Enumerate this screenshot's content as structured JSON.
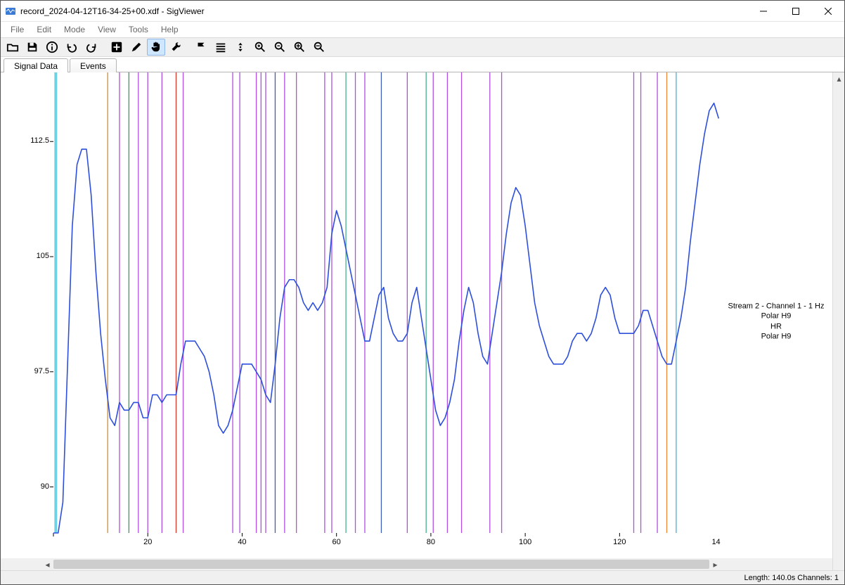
{
  "window": {
    "title": "record_2024-04-12T16-34-25+00.xdf - SigViewer"
  },
  "menu": {
    "file": "File",
    "edit": "Edit",
    "mode": "Mode",
    "view": "View",
    "tools": "Tools",
    "help": "Help"
  },
  "tabs": {
    "signal": "Signal Data",
    "events": "Events"
  },
  "side_label": {
    "l1": "Stream 2 - Channel 1 - 1 Hz",
    "l2": "Polar H9",
    "l3": "HR",
    "l4": "Polar H9"
  },
  "status": {
    "text": "Length: 140.0s  Channels: 1"
  },
  "chart_data": {
    "type": "line",
    "xlabel": "",
    "ylabel": "",
    "xlim": [
      0,
      142
    ],
    "ylim": [
      87,
      117
    ],
    "x_ticks": [
      20,
      40,
      60,
      80,
      100,
      120
    ],
    "x_tick_label_extra": "14",
    "y_ticks": [
      90,
      97.5,
      105,
      112.5
    ],
    "series": [
      {
        "name": "HR",
        "color": "#2d4fdc",
        "x": [
          0,
          1,
          2,
          3,
          4,
          5,
          6,
          7,
          8,
          9,
          10,
          11,
          12,
          13,
          14,
          15,
          16,
          17,
          18,
          19,
          20,
          21,
          22,
          23,
          24,
          25,
          26,
          27,
          28,
          29,
          30,
          31,
          32,
          33,
          34,
          35,
          36,
          37,
          38,
          39,
          40,
          41,
          42,
          43,
          44,
          45,
          46,
          47,
          48,
          49,
          50,
          51,
          52,
          53,
          54,
          55,
          56,
          57,
          58,
          59,
          60,
          61,
          62,
          63,
          64,
          65,
          66,
          67,
          68,
          69,
          70,
          71,
          72,
          73,
          74,
          75,
          76,
          77,
          78,
          79,
          80,
          81,
          82,
          83,
          84,
          85,
          86,
          87,
          88,
          89,
          90,
          91,
          92,
          93,
          94,
          95,
          96,
          97,
          98,
          99,
          100,
          101,
          102,
          103,
          104,
          105,
          106,
          107,
          108,
          109,
          110,
          111,
          112,
          113,
          114,
          115,
          116,
          117,
          118,
          119,
          120,
          121,
          122,
          123,
          124,
          125,
          126,
          127,
          128,
          129,
          130,
          131,
          132,
          133,
          134,
          135,
          136,
          137,
          138,
          139,
          140,
          141
        ],
        "y": [
          87,
          87,
          89,
          98,
          107,
          111,
          112,
          112,
          109,
          104,
          100,
          97,
          94.5,
          94,
          95.5,
          95,
          95,
          95.5,
          95.5,
          94.5,
          94.5,
          96,
          96,
          95.5,
          96,
          96,
          96,
          98,
          99.5,
          99.5,
          99.5,
          99,
          98.5,
          97.5,
          96,
          94,
          93.5,
          94,
          95,
          96.5,
          98,
          98,
          98,
          97.5,
          97,
          96,
          95.5,
          98,
          101,
          103,
          103.5,
          103.5,
          103,
          102,
          101.5,
          102,
          101.5,
          102,
          103,
          106.5,
          108,
          107,
          105.5,
          104,
          102.5,
          101,
          99.5,
          99.5,
          101,
          102.5,
          103,
          101,
          100,
          99.5,
          99.5,
          100,
          102,
          103,
          101,
          99,
          97,
          95,
          94,
          94.5,
          95.5,
          97,
          99.5,
          101.5,
          103,
          102,
          100,
          98.5,
          98,
          100,
          102,
          104,
          106.5,
          108.5,
          109.5,
          109,
          107,
          104.5,
          102,
          100.5,
          99.5,
          98.5,
          98,
          98,
          98,
          98.5,
          99.5,
          100,
          100,
          99.5,
          100,
          101,
          102.5,
          103,
          102.5,
          101,
          100,
          100,
          100,
          100,
          100.5,
          101.5,
          101.5,
          100.5,
          99.5,
          98.5,
          98,
          98,
          99.5,
          101,
          103,
          106,
          108.5,
          111,
          113,
          114.5,
          115,
          114
        ]
      }
    ],
    "events": [
      {
        "x": 0.5,
        "color": "#6fd1e6",
        "w": 4
      },
      {
        "x": 11.5,
        "color": "#d68b2b"
      },
      {
        "x": 14.0,
        "color": "#b24fe0"
      },
      {
        "x": 16.0,
        "color": "#3a9b5b"
      },
      {
        "x": 18.0,
        "color": "#b24fe0"
      },
      {
        "x": 20.0,
        "color": "#b24fe0"
      },
      {
        "x": 23.0,
        "color": "#b24fe0"
      },
      {
        "x": 26.0,
        "color": "#cf3b2c"
      },
      {
        "x": 27.5,
        "color": "#b24fe0"
      },
      {
        "x": 38.0,
        "color": "#b24fe0"
      },
      {
        "x": 39.5,
        "color": "#b24fe0"
      },
      {
        "x": 43.0,
        "color": "#b24fe0"
      },
      {
        "x": 44.0,
        "color": "#b24fe0"
      },
      {
        "x": 45.0,
        "color": "#b24fe0"
      },
      {
        "x": 47.0,
        "color": "#3f5fb8"
      },
      {
        "x": 49.0,
        "color": "#b24fe0"
      },
      {
        "x": 51.5,
        "color": "#b24fe0"
      },
      {
        "x": 57.5,
        "color": "#b24fe0"
      },
      {
        "x": 59.0,
        "color": "#b24fe0"
      },
      {
        "x": 62.0,
        "color": "#49b08f"
      },
      {
        "x": 64.0,
        "color": "#b24fe0"
      },
      {
        "x": 66.0,
        "color": "#b24fe0"
      },
      {
        "x": 69.5,
        "color": "#3f5fb8"
      },
      {
        "x": 75.0,
        "color": "#b24fe0"
      },
      {
        "x": 79.0,
        "color": "#49b08f"
      },
      {
        "x": 80.5,
        "color": "#b24fe0"
      },
      {
        "x": 83.5,
        "color": "#b24fe0"
      },
      {
        "x": 86.5,
        "color": "#b24fe0"
      },
      {
        "x": 92.5,
        "color": "#b24fe0"
      },
      {
        "x": 95.0,
        "color": "#b24fe0"
      },
      {
        "x": 123.0,
        "color": "#b24fe0"
      },
      {
        "x": 124.5,
        "color": "#b24fe0"
      },
      {
        "x": 128.0,
        "color": "#b24fe0"
      },
      {
        "x": 130.0,
        "color": "#ec8a3a"
      },
      {
        "x": 132.0,
        "color": "#49b0d8"
      }
    ]
  }
}
